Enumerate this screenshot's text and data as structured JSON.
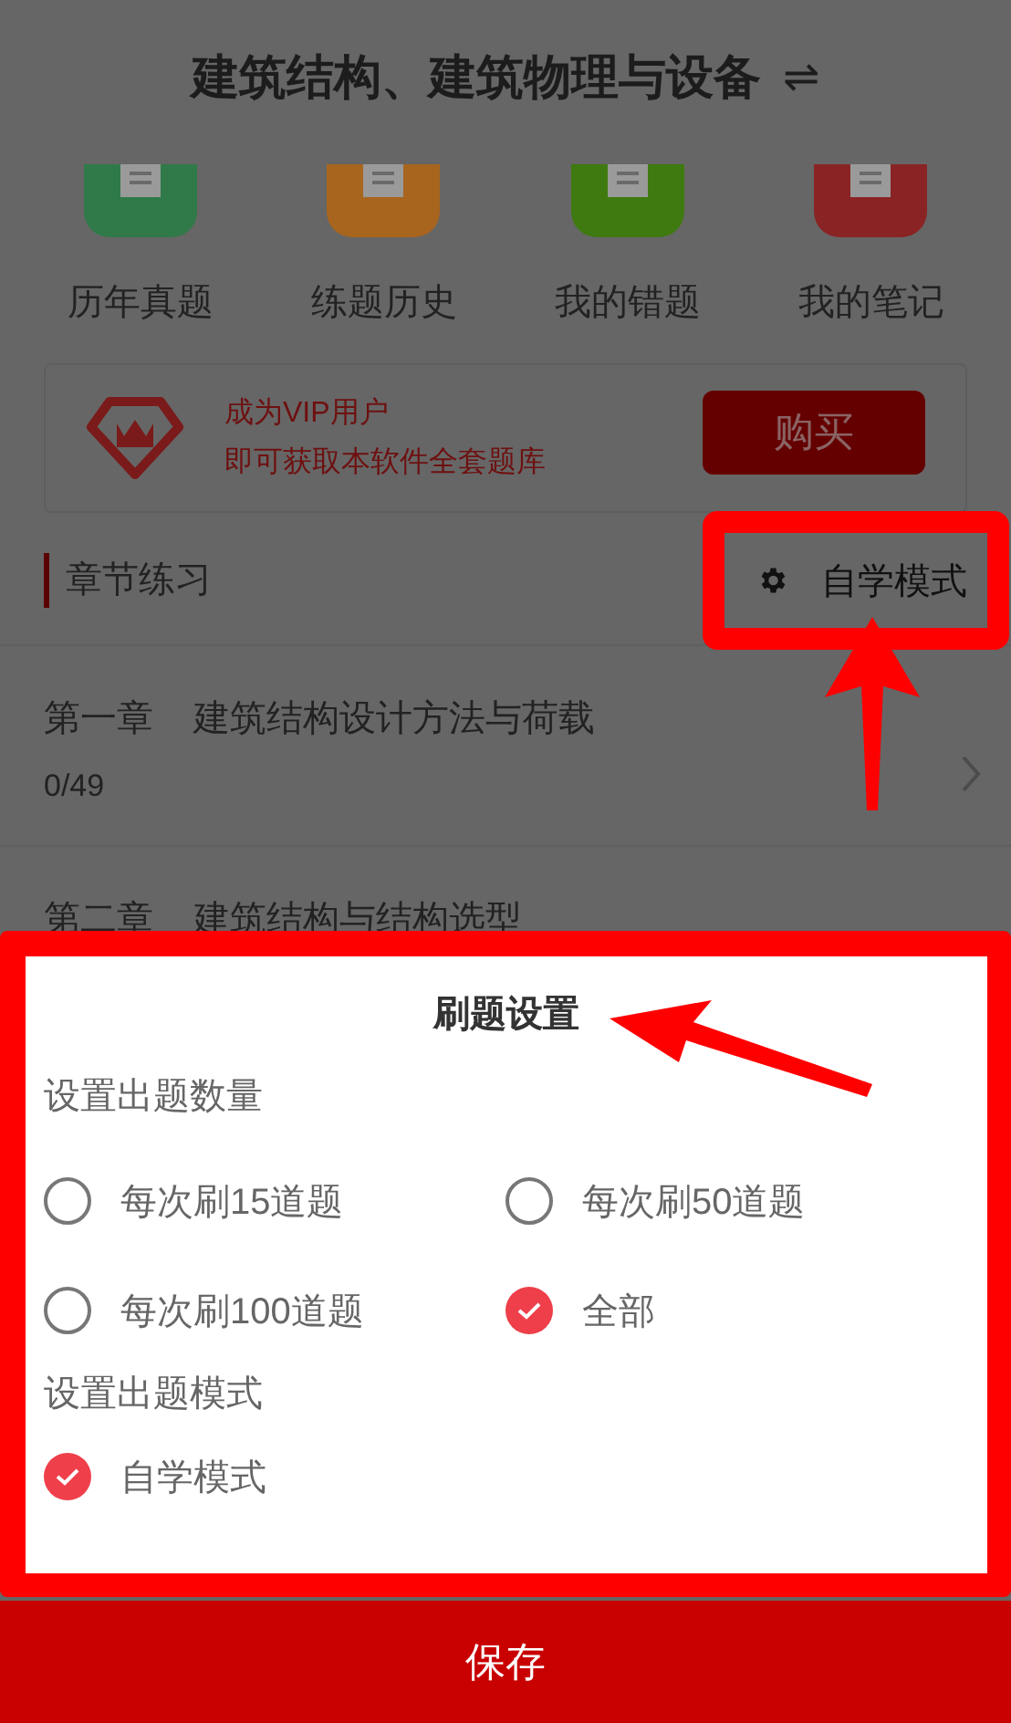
{
  "header": {
    "title": "建筑结构、建筑物理与设备",
    "switch_icon": "⇌"
  },
  "shortcuts": [
    {
      "label": "历年真题",
      "color": "#2f7a48"
    },
    {
      "label": "练题历史",
      "color": "#a8651e"
    },
    {
      "label": "我的错题",
      "color": "#3f7a10"
    },
    {
      "label": "我的笔记",
      "color": "#8a2424"
    }
  ],
  "vip": {
    "line1": "成为VIP用户",
    "line2": "即可获取本软件全套题库",
    "button": "购买"
  },
  "section": {
    "title": "章节练习",
    "mode": "自学模式"
  },
  "chapters": [
    {
      "number": "第一章",
      "title": "建筑结构设计方法与荷载",
      "progress": "0/49"
    },
    {
      "number": "第二章",
      "title": "建筑结构与结构选型"
    }
  ],
  "dialog": {
    "title": "刷题设置",
    "groups": [
      {
        "label": "设置出题数量",
        "options": [
          {
            "label": "每次刷15道题",
            "selected": false
          },
          {
            "label": "每次刷50道题",
            "selected": false
          },
          {
            "label": "每次刷100道题",
            "selected": false
          },
          {
            "label": "全部",
            "selected": true
          }
        ]
      },
      {
        "label": "设置出题模式",
        "options": [
          {
            "label": "自学模式",
            "selected": true
          }
        ]
      }
    ]
  },
  "save_button": "保存"
}
